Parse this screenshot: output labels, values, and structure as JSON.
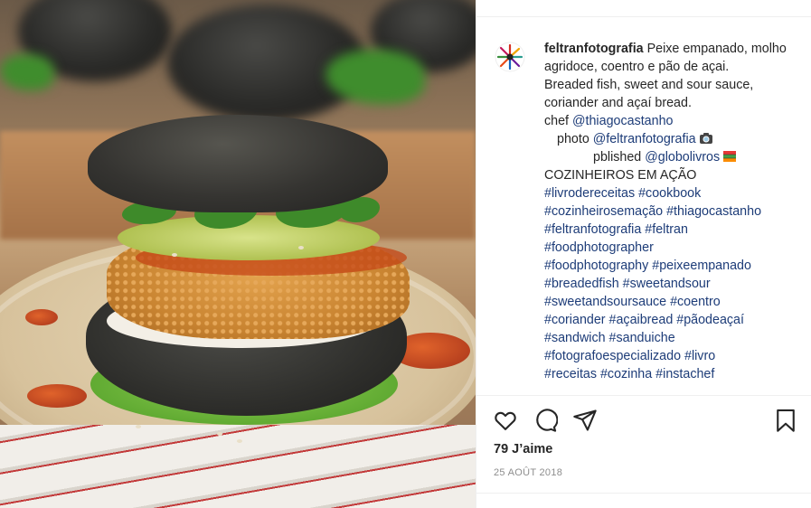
{
  "post": {
    "photo_alt": "Breaded fish burger on charcoal açaí bun",
    "username": "feltranfotografia"
  },
  "caption": {
    "text_1": " Peixe empanado, molho agridoce, coentro e pão de açai.",
    "text_2": "Breaded fish, sweet and sour sauce, coriander and açaí bread.",
    "chef_prefix": "chef ",
    "chef_handle": "@thiagocastanho",
    "photo_prefix": "photo ",
    "photo_handle": "@feltranfotografia",
    "photo_emoji": "camera-emoji",
    "published_prefix": "pblished ",
    "published_handle": "@globolivros",
    "published_emoji": "books-emoji",
    "heading": "COZINHEIROS EM AÇÃO",
    "hashtag_lines": [
      "#livrodereceitas #cookbook",
      "#cozinheirosemação #thiagocastanho",
      "#feltranfotografia #feltran",
      "#foodphotographer",
      "#foodphotography #peixeempanado",
      "#breadedfish #sweetandsour",
      "#sweetandsoursauce #coentro",
      "#coriander #açaibread #pãodeaçaí",
      "#sandwich #sanduiche",
      "#fotografoespecializado #livro",
      "#receitas #cozinha #instachef"
    ]
  },
  "actions": {
    "like_icon": "heart-icon",
    "comment_icon": "comment-icon",
    "share_icon": "share-icon",
    "save_icon": "bookmark-icon"
  },
  "likes": "79 J’aime",
  "date": "25 AOÛT 2018",
  "colors": {
    "link": "#1d3c78",
    "text": "#262626",
    "muted": "#8e8e8e"
  }
}
